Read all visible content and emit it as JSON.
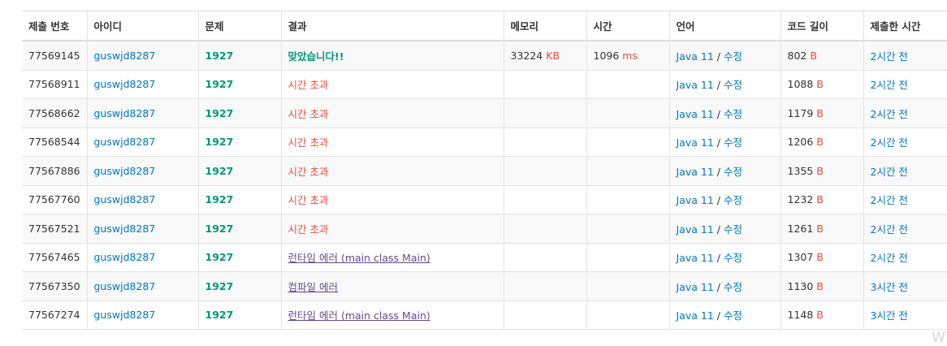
{
  "columns": [
    "제출 번호",
    "아이디",
    "문제",
    "결과",
    "메모리",
    "시간",
    "언어",
    "코드 길이",
    "제출한 시간"
  ],
  "rows": [
    {
      "id": "77569145",
      "user": "guswjd8287",
      "problem": "1927",
      "result": "맞았습니다!!",
      "result_type": "ok",
      "memory": "33224",
      "memory_unit": "KB",
      "time": "1096",
      "time_unit": "ms",
      "lang": "Java 11",
      "edit": "수정",
      "sep": " / ",
      "length": "802",
      "length_unit": "B",
      "submitted": "2시간 전"
    },
    {
      "id": "77568911",
      "user": "guswjd8287",
      "problem": "1927",
      "result": "시간 초과",
      "result_type": "tle",
      "memory": "",
      "memory_unit": "",
      "time": "",
      "time_unit": "",
      "lang": "Java 11",
      "edit": "수정",
      "sep": " / ",
      "length": "1088",
      "length_unit": "B",
      "submitted": "2시간 전"
    },
    {
      "id": "77568662",
      "user": "guswjd8287",
      "problem": "1927",
      "result": "시간 초과",
      "result_type": "tle",
      "memory": "",
      "memory_unit": "",
      "time": "",
      "time_unit": "",
      "lang": "Java 11",
      "edit": "수정",
      "sep": " / ",
      "length": "1179",
      "length_unit": "B",
      "submitted": "2시간 전"
    },
    {
      "id": "77568544",
      "user": "guswjd8287",
      "problem": "1927",
      "result": "시간 초과",
      "result_type": "tle",
      "memory": "",
      "memory_unit": "",
      "time": "",
      "time_unit": "",
      "lang": "Java 11",
      "edit": "수정",
      "sep": " / ",
      "length": "1206",
      "length_unit": "B",
      "submitted": "2시간 전"
    },
    {
      "id": "77567886",
      "user": "guswjd8287",
      "problem": "1927",
      "result": "시간 초과",
      "result_type": "tle",
      "memory": "",
      "memory_unit": "",
      "time": "",
      "time_unit": "",
      "lang": "Java 11",
      "edit": "수정",
      "sep": " / ",
      "length": "1355",
      "length_unit": "B",
      "submitted": "2시간 전"
    },
    {
      "id": "77567760",
      "user": "guswjd8287",
      "problem": "1927",
      "result": "시간 초과",
      "result_type": "tle",
      "memory": "",
      "memory_unit": "",
      "time": "",
      "time_unit": "",
      "lang": "Java 11",
      "edit": "수정",
      "sep": " / ",
      "length": "1232",
      "length_unit": "B",
      "submitted": "2시간 전"
    },
    {
      "id": "77567521",
      "user": "guswjd8287",
      "problem": "1927",
      "result": "시간 초과",
      "result_type": "tle",
      "memory": "",
      "memory_unit": "",
      "time": "",
      "time_unit": "",
      "lang": "Java 11",
      "edit": "수정",
      "sep": " / ",
      "length": "1261",
      "length_unit": "B",
      "submitted": "2시간 전"
    },
    {
      "id": "77567465",
      "user": "guswjd8287",
      "problem": "1927",
      "result": "런타임 에러 (main class Main)",
      "result_type": "err",
      "memory": "",
      "memory_unit": "",
      "time": "",
      "time_unit": "",
      "lang": "Java 11",
      "edit": "수정",
      "sep": " / ",
      "length": "1307",
      "length_unit": "B",
      "submitted": "2시간 전"
    },
    {
      "id": "77567350",
      "user": "guswjd8287",
      "problem": "1927",
      "result": "컴파일 에러",
      "result_type": "err",
      "memory": "",
      "memory_unit": "",
      "time": "",
      "time_unit": "",
      "lang": "Java 11",
      "edit": "수정",
      "sep": " / ",
      "length": "1130",
      "length_unit": "B",
      "submitted": "3시간 전"
    },
    {
      "id": "77567274",
      "user": "guswjd8287",
      "problem": "1927",
      "result": "런타임 에러 (main class Main)",
      "result_type": "err",
      "memory": "",
      "memory_unit": "",
      "time": "",
      "time_unit": "",
      "lang": "Java 11",
      "edit": "수정",
      "sep": " / ",
      "length": "1148",
      "length_unit": "B",
      "submitted": "3시간 전"
    }
  ],
  "watermark": "W",
  "colors": {
    "link": "#0076c0",
    "accepted": "#009874",
    "error": "#e74c3c",
    "compile": "#5f4b8b"
  }
}
